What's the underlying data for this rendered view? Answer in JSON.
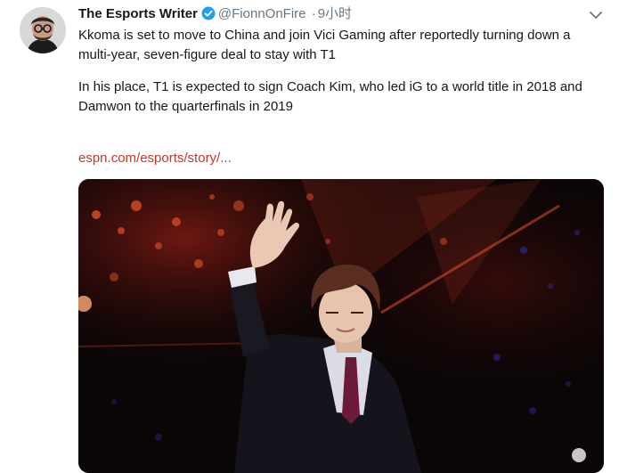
{
  "tweet": {
    "author_name": "The Esports Writer",
    "handle": "@FionnOnFire",
    "separator": "·",
    "time": "9小时",
    "paragraphs": [
      "Kkoma is set to move to China and join Vici Gaming after reportedly turning down a multi-year, seven-figure deal to stay with T1",
      "In his place, T1 is expected to sign Coach Kim, who led iG to a world title in 2018 and Damwon to the quarterfinals in 2019"
    ],
    "link_text": "espn.com/esports/story/..."
  },
  "icons": {
    "verified": "verified-badge-icon",
    "caret": "chevron-down-icon"
  },
  "colors": {
    "verified_blue": "#1da1f2",
    "link": "#c0392b",
    "meta_gray": "#657786",
    "stage_orange": "#e0502a"
  }
}
